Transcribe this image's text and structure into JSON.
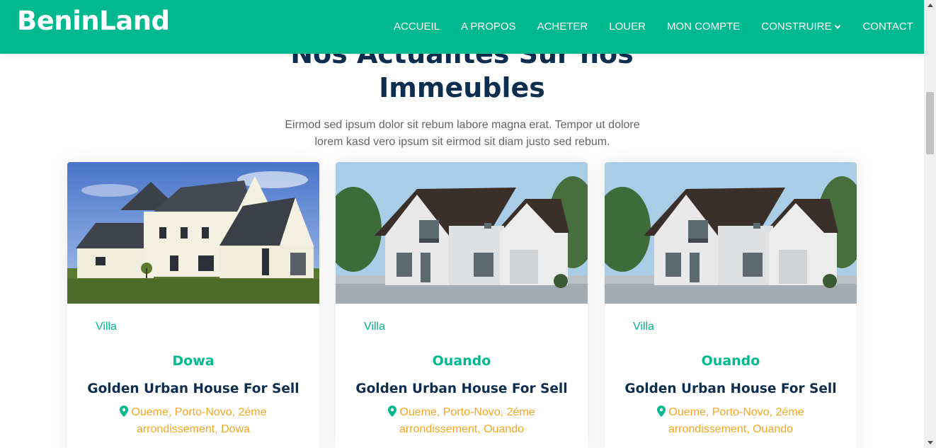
{
  "brand": "BeninLand",
  "nav": [
    {
      "label": "ACCUEIL"
    },
    {
      "label": "A PROPOS"
    },
    {
      "label": "ACHETER"
    },
    {
      "label": "LOUER"
    },
    {
      "label": "MON COMPTE"
    },
    {
      "label": "CONSTRUIRE",
      "has_dropdown": true
    },
    {
      "label": "CONTACT"
    }
  ],
  "section": {
    "title_line1": "Nos Actualites Sur nos",
    "title_line2": "Immeubles",
    "subtitle": "Eirmod sed ipsum dolor sit rebum labore magna erat. Tempor ut dolore lorem kasd vero ipsum sit eirmod sit diam justo sed rebum."
  },
  "cards": [
    {
      "image": "house-photo-1",
      "category": "Villa",
      "city": "Dowa",
      "title": "Golden Urban House For Sell",
      "address": "Oueme, Porto-Novo, 2éme arrondissement, Dowa",
      "location_icon": "map-marker-icon"
    },
    {
      "image": "house-photo-2",
      "category": "Villa",
      "city": "Ouando",
      "title": "Golden Urban House For Sell",
      "address": "Oueme, Porto-Novo, 2éme arrondissement, Ouando",
      "location_icon": "map-marker-icon"
    },
    {
      "image": "house-photo-2",
      "category": "Villa",
      "city": "Ouando",
      "title": "Golden Urban House For Sell",
      "address": "Oueme, Porto-Novo, 2éme arrondissement, Ouando",
      "location_icon": "map-marker-icon"
    }
  ],
  "colors": {
    "primary": "#00b98e",
    "heading": "#0e2e50",
    "text": "#666565",
    "address": "#f6a623"
  }
}
